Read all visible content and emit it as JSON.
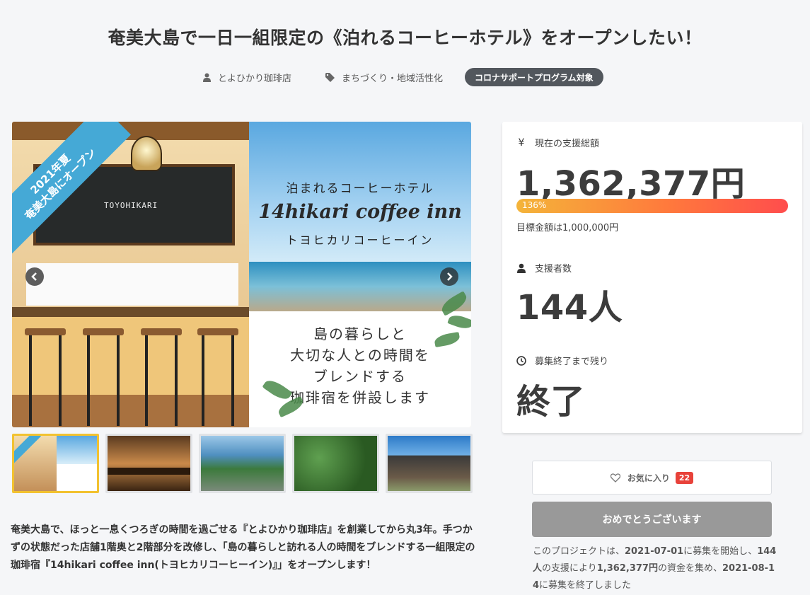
{
  "project": {
    "title": "奄美大島で一日一組限定の《泊れるコーヒーホテル》をオープンしたい！",
    "owner": "とよひかり珈琲店",
    "category": "まちづくり・地域活性化",
    "badge": "コロナサポートプログラム対象"
  },
  "hero": {
    "ribbon_line1": "2021年夏",
    "ribbon_line2": "奄美大島にオープン",
    "subtitle": "泊まれるコーヒーホテル",
    "name": "14hikari coffee inn",
    "kana": "トヨヒカリコーヒーイン",
    "tagline": [
      "島の暮らしと",
      "大切な人との時間を",
      "ブレンドする",
      "珈琲宿を併設します"
    ],
    "chalkboard": "TOYOHIKARI",
    "prev_icon": "chevron-left-icon",
    "next_icon": "chevron-right-icon"
  },
  "thumbnails": [
    {
      "name": "thumb-poster",
      "active": true
    },
    {
      "name": "thumb-cafe-interior",
      "active": false
    },
    {
      "name": "thumb-island-view",
      "active": false
    },
    {
      "name": "thumb-coffee-seedlings",
      "active": false
    },
    {
      "name": "thumb-old-house",
      "active": false
    }
  ],
  "description": "奄美大島で、ほっと一息くつろぎの時間を過ごせる『とよひかり珈琲店』を創業してから丸3年。手つかずの状態だった店舗1階奥と2階部分を改修し、「島の暮らしと訪れる人の時間をブレンドする一組限定の珈琲宿『14hikari coffee inn(トヨヒカリコーヒーイン)』」をオープンします！",
  "stats": {
    "total_label": "現在の支援総額",
    "total_icon": "¥",
    "total_value": "1,362,377円",
    "progress_percent": 136,
    "progress_label": "136%",
    "goal_text": "目標金額は1,000,000円",
    "backers_label": "支援者数",
    "backers_value": "144人",
    "remaining_label": "募集終了まで残り",
    "remaining_value": "終了"
  },
  "actions": {
    "favorite_label": "お気に入り",
    "favorite_count": "22",
    "congrats_label": "おめでとうございます"
  },
  "summary": {
    "p1": "このプロジェクトは、",
    "start_date": "2021-07-01",
    "p2": "に募集を開始し、",
    "backers": "144人",
    "p3": "の支援により",
    "amount": "1,362,377円",
    "p4": "の資金を集め、",
    "end_date": "2021-08-14",
    "p5": "に募集を終了しました"
  },
  "colors": {
    "accent": "#ff4d4d",
    "badge_bg": "#52575d",
    "ribbon": "#45a9d6",
    "thumb_active": "#f2c230",
    "fav_count_bg": "#e8423a",
    "disabled_button": "#999999"
  }
}
